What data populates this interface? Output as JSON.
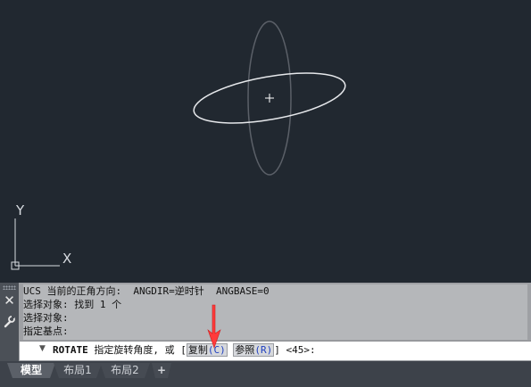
{
  "ucs": {
    "y_label": "Y",
    "x_label": "X"
  },
  "command_window": {
    "close_icon": "close-icon",
    "settings_icon": "wrench-icon",
    "history": [
      "UCS 当前的正角方向:  ANGDIR=逆时针  ANGBASE=0",
      "选择对象: 找到 1 个",
      "选择对象:",
      "指定基点:"
    ],
    "prompt": {
      "command": "ROTATE",
      "text": "指定旋转角度, 或 [",
      "option1_label": "复制",
      "option1_key": "(C)",
      "option2_label": "参照",
      "option2_key": "(R)",
      "tail": "] <45>:"
    }
  },
  "tabs": [
    {
      "label": "模型",
      "active": true
    },
    {
      "label": "布局1",
      "active": false
    },
    {
      "label": "布局2",
      "active": false
    },
    {
      "label": "+",
      "active": false
    }
  ],
  "colors": {
    "canvas_bg": "#212830",
    "annotation_arrow": "#ff3b3b",
    "option_key": "#1f3fbf"
  }
}
